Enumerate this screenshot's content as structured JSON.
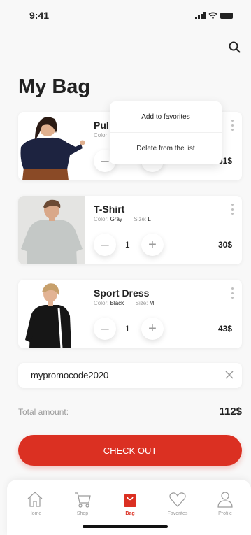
{
  "status_bar": {
    "time": "9:41"
  },
  "page": {
    "title": "My Bag"
  },
  "context_menu": {
    "add_to_favorites": "Add to favorites",
    "delete_from_list": "Delete from the list"
  },
  "items": [
    {
      "name": "Pul",
      "color_label": "Color",
      "color": "",
      "size_label": "",
      "size": "",
      "quantity": "",
      "price": "51$"
    },
    {
      "name": "T-Shirt",
      "color_label": "Color:",
      "color": "Gray",
      "size_label": "Size:",
      "size": "L",
      "quantity": "1",
      "price": "30$"
    },
    {
      "name": "Sport Dress",
      "color_label": "Color:",
      "color": "Black",
      "size_label": "Size:",
      "size": "M",
      "quantity": "1",
      "price": "43$"
    }
  ],
  "promo": {
    "code": "mypromocode2020"
  },
  "total": {
    "label": "Total amount:",
    "value": "112$"
  },
  "checkout": {
    "label": "CHECK OUT"
  },
  "tabbar": {
    "tabs": [
      {
        "label": "Home",
        "icon": "home-icon",
        "active": false
      },
      {
        "label": "Shop",
        "icon": "cart-icon",
        "active": false
      },
      {
        "label": "Bag",
        "icon": "bag-icon",
        "active": true
      },
      {
        "label": "Favorites",
        "icon": "heart-icon",
        "active": false
      },
      {
        "label": "Profile",
        "icon": "profile-icon",
        "active": false
      }
    ]
  },
  "colors": {
    "accent": "#db3022",
    "background": "#f8f8f8",
    "text": "#222222",
    "muted": "#9b9b9b"
  }
}
